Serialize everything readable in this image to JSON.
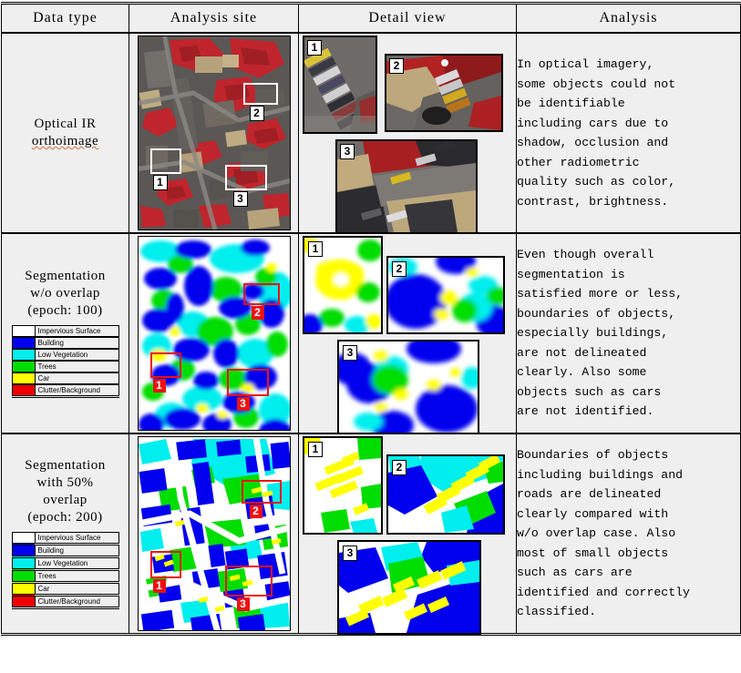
{
  "table": {
    "headers": [
      "Data  type",
      "Analysis  site",
      "Detail view",
      "Analysis"
    ],
    "rows": [
      {
        "data_type": {
          "line1": "Optical IR",
          "line2": "orthoimage",
          "spellcheck_underline_on": "orthoimage",
          "has_legend": false
        },
        "site": {
          "caption": "false-colour IR orthoimage of dense urban block",
          "markers": [
            "1",
            "2",
            "3"
          ],
          "marker_style": "white-box"
        },
        "details": {
          "panels": [
            {
              "label": "1",
              "caption": "car park with row of parked cars"
            },
            {
              "label": "2",
              "caption": "cars along kerb beside red vegetation"
            },
            {
              "label": "3",
              "caption": "street with cars in shadow of buildings"
            }
          ],
          "label_style": "white-box"
        },
        "analysis": "In optical imagery,\nsome objects could not\nbe identifiable\nincluding cars due to\nshadow, occlusion and\nother radiometric\nquality such as color,\ncontrast, brightness."
      },
      {
        "data_type": {
          "line1": "Segmentation",
          "line2": "w/o overlap",
          "line3": "(epoch: 100)",
          "has_legend": true
        },
        "site": {
          "caption": "coarse segmentation map, blobby class regions",
          "markers": [
            "1",
            "2",
            "3"
          ],
          "marker_style": "red-box"
        },
        "details": {
          "panels": [
            {
              "label": "1",
              "caption": "merged yellow car blob, no individual cars"
            },
            {
              "label": "2",
              "caption": "rounded building blob, soft boundaries"
            },
            {
              "label": "3",
              "caption": "blurred road and building edges"
            }
          ],
          "label_style": "white-box"
        },
        "analysis": "Even though overall\nsegmentation is\nsatisfied more or less,\nboundaries of objects,\nespecially buildings,\nare not delineated\nclearly. Also some\nobjects such as cars\nare not identified."
      },
      {
        "data_type": {
          "line1": "Segmentation",
          "line2": "with 50%",
          "line3": "overlap",
          "line4": "(epoch: 200)",
          "has_legend": true
        },
        "site": {
          "caption": "refined segmentation map, sharp straight edges",
          "markers": [
            "1",
            "2",
            "3"
          ],
          "marker_style": "red-box"
        },
        "details": {
          "panels": [
            {
              "label": "1",
              "caption": "separate yellow car rectangles in car park"
            },
            {
              "label": "2",
              "caption": "row of distinct cars along road"
            },
            {
              "label": "3",
              "caption": "cars resolved along straight road corridor"
            }
          ],
          "label_style": "white-box"
        },
        "analysis": "Boundaries of objects\nincluding buildings and\nroads are delineated\nclearly compared with\nw/o overlap case. Also\nmost of small objects\nsuch as cars are\nidentified and correctly\nclassified."
      }
    ]
  },
  "legend": {
    "items": [
      {
        "label": "Impervious Surface",
        "color": "#ffffff"
      },
      {
        "label": "Building",
        "color": "#0000ee"
      },
      {
        "label": "Low Vegetation",
        "color": "#00eeee"
      },
      {
        "label": "Trees",
        "color": "#00dd00"
      },
      {
        "label": "Car",
        "color": "#ffff00"
      },
      {
        "label": "Clutter/Background",
        "color": "#ee0000"
      }
    ]
  },
  "palette": {
    "impervious": "#ffffff",
    "building": "#0000ee",
    "low_vegetation": "#00eeee",
    "trees": "#00dd00",
    "car": "#ffff00",
    "clutter": "#ee0000",
    "marker_red": "#ee1111",
    "table_bg": "#efefef",
    "spell_underline": "#d4703a"
  }
}
